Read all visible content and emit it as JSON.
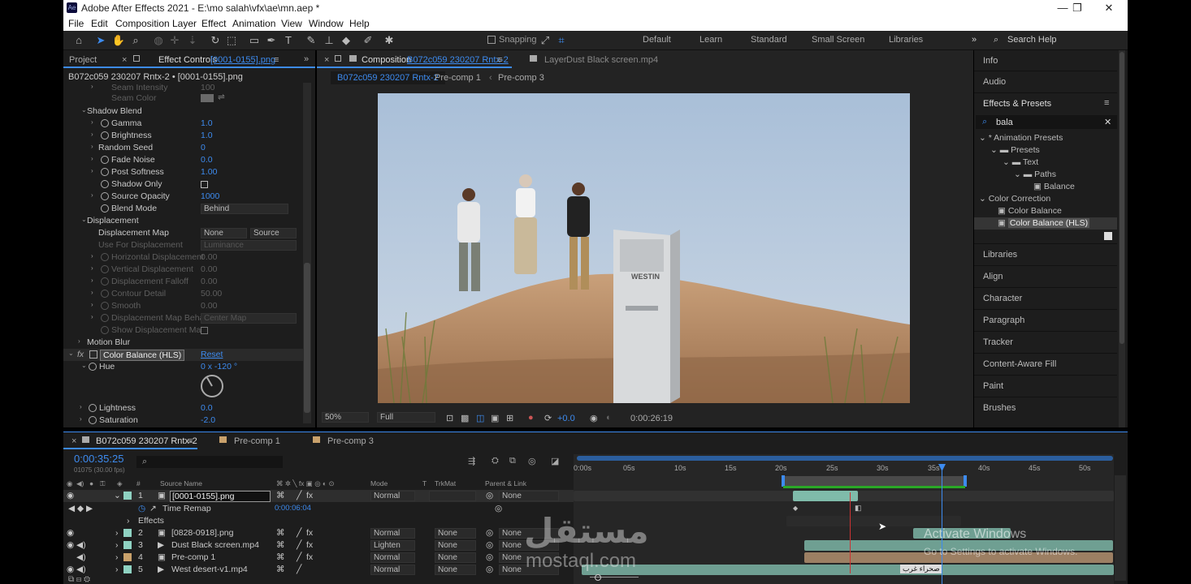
{
  "app": {
    "title": "Adobe After Effects 2021 - E:\\mo salah\\vfx\\ae\\mn.aep *",
    "icon": "Ae"
  },
  "menu": [
    "File",
    "Edit",
    "Composition",
    "Layer",
    "Effect",
    "Animation",
    "View",
    "Window",
    "Help"
  ],
  "toolbar": {
    "snapping": "Snapping",
    "workspaces": [
      "Default",
      "Learn",
      "Standard",
      "Small Screen",
      "Libraries"
    ],
    "search_help": "Search Help"
  },
  "left": {
    "project_tab": "Project",
    "effect_controls_tab": "Effect Controls",
    "effect_controls_layer": "[0001-0155].png",
    "breadcrumb": "B072c059 230207 Rntx-2 • [0001-0155].png",
    "rows": [
      {
        "label": "Seam Intensity",
        "value": "100"
      },
      {
        "label": "Seam Color",
        "value": ""
      },
      {
        "label": "Shadow Blend",
        "value": ""
      },
      {
        "label": "Gamma",
        "value": "1.0"
      },
      {
        "label": "Brightness",
        "value": "1.0"
      },
      {
        "label": "Random Seed",
        "value": "0"
      },
      {
        "label": "Fade Noise",
        "value": "0.0"
      },
      {
        "label": "Post Softness",
        "value": "1.00"
      },
      {
        "label": "Shadow Only",
        "value": ""
      },
      {
        "label": "Source Opacity",
        "value": "1000"
      },
      {
        "label": "Blend Mode",
        "value": "Behind"
      },
      {
        "label": "Displacement",
        "value": ""
      },
      {
        "label": "Displacement Map",
        "value": "None"
      },
      {
        "label": "Use For Displacement",
        "value": "Luminance"
      },
      {
        "label": "Horizontal Displacement",
        "value": "0.00"
      },
      {
        "label": "Vertical Displacement",
        "value": "0.00"
      },
      {
        "label": "Displacement Falloff",
        "value": "0.00"
      },
      {
        "label": "Contour Detail",
        "value": "50.00"
      },
      {
        "label": "Smooth",
        "value": "0.00"
      },
      {
        "label": "Displacement Map Beha",
        "value": "Center Map"
      },
      {
        "label": "Show Displacement Ma",
        "value": ""
      },
      {
        "label": "Motion Blur",
        "value": ""
      },
      {
        "label": "Color Balance (HLS)",
        "value": "Reset"
      },
      {
        "label": "Hue",
        "value": "0 x -120 °"
      },
      {
        "label": "Lightness",
        "value": "0.0"
      },
      {
        "label": "Saturation",
        "value": "-2.0"
      }
    ],
    "source_label": "Source",
    "fx": "fx"
  },
  "comp": {
    "tab_label": "Composition",
    "tab_name": "B072c059 230207 Rntx-2",
    "layer_tab": "Layer",
    "layer_name": "Dust Black screen.mp4",
    "subtabs": [
      "B072c059 230207 Rntx-2",
      "Pre-comp 1",
      "Pre-comp 3"
    ],
    "zoom": "50%",
    "resolution": "Full",
    "exposure": "+0.0",
    "timecode": "0:00:26:19",
    "cabinet_brand": "WESTIN"
  },
  "right": {
    "panels_top": [
      "Info",
      "Audio"
    ],
    "effects_presets": "Effects & Presets",
    "search": "bala",
    "tree": [
      {
        "label": "* Animation Presets"
      },
      {
        "label": "Presets"
      },
      {
        "label": "Text"
      },
      {
        "label": "Paths"
      },
      {
        "label": "Balance"
      },
      {
        "label": "Color Correction"
      },
      {
        "label": "Color Balance"
      },
      {
        "label": "Color Balance (HLS)"
      }
    ],
    "panels": [
      "Libraries",
      "Align",
      "Character",
      "Paragraph",
      "Tracker",
      "Content-Aware Fill",
      "Paint",
      "Brushes"
    ]
  },
  "timeline": {
    "tabs": [
      "B072c059 230207 Rntx-2",
      "Pre-comp 1",
      "Pre-comp 3"
    ],
    "timecode": "0:00:35:25",
    "frames": "01075 (30.00 fps)",
    "headers": {
      "source": "Source Name",
      "mode": "Mode",
      "t": "T",
      "trkmat": "TrkMat",
      "parent": "Parent & Link",
      "num": "#"
    },
    "ruler": [
      "0:00s",
      "05s",
      "10s",
      "15s",
      "20s",
      "25s",
      "30s",
      "35s",
      "40s",
      "45s",
      "50s"
    ],
    "layers": [
      {
        "num": "1",
        "name": "[0001-0155].png",
        "mode": "Normal",
        "trkmat": "",
        "parent": "None"
      },
      {
        "num": "2",
        "name": "[0828-0918].png",
        "mode": "Normal",
        "trkmat": "None",
        "parent": "None"
      },
      {
        "num": "3",
        "name": "Dust Black screen.mp4",
        "mode": "Lighten",
        "trkmat": "None",
        "parent": "None"
      },
      {
        "num": "4",
        "name": "Pre-comp 1",
        "mode": "Normal",
        "trkmat": "None",
        "parent": "None"
      },
      {
        "num": "5",
        "name": "West desert-v1.mp4",
        "mode": "Normal",
        "trkmat": "None",
        "parent": "None"
      }
    ],
    "time_remap": "Time Remap",
    "time_remap_value": "0:00:06:04",
    "effects": "Effects",
    "clip_label": "صحراء غرب"
  },
  "watermark": {
    "activate": "Activate Windows",
    "activate_sub": "Go to Settings to activate Windows.",
    "brand_ar": "مستقل",
    "brand": "mostaql.com"
  },
  "colors": {
    "accent": "#3d8bef",
    "panel": "#1d1d1d",
    "sky": "#b8c9dc",
    "sand": "#c0916a",
    "green_bar": "#2aa827"
  }
}
